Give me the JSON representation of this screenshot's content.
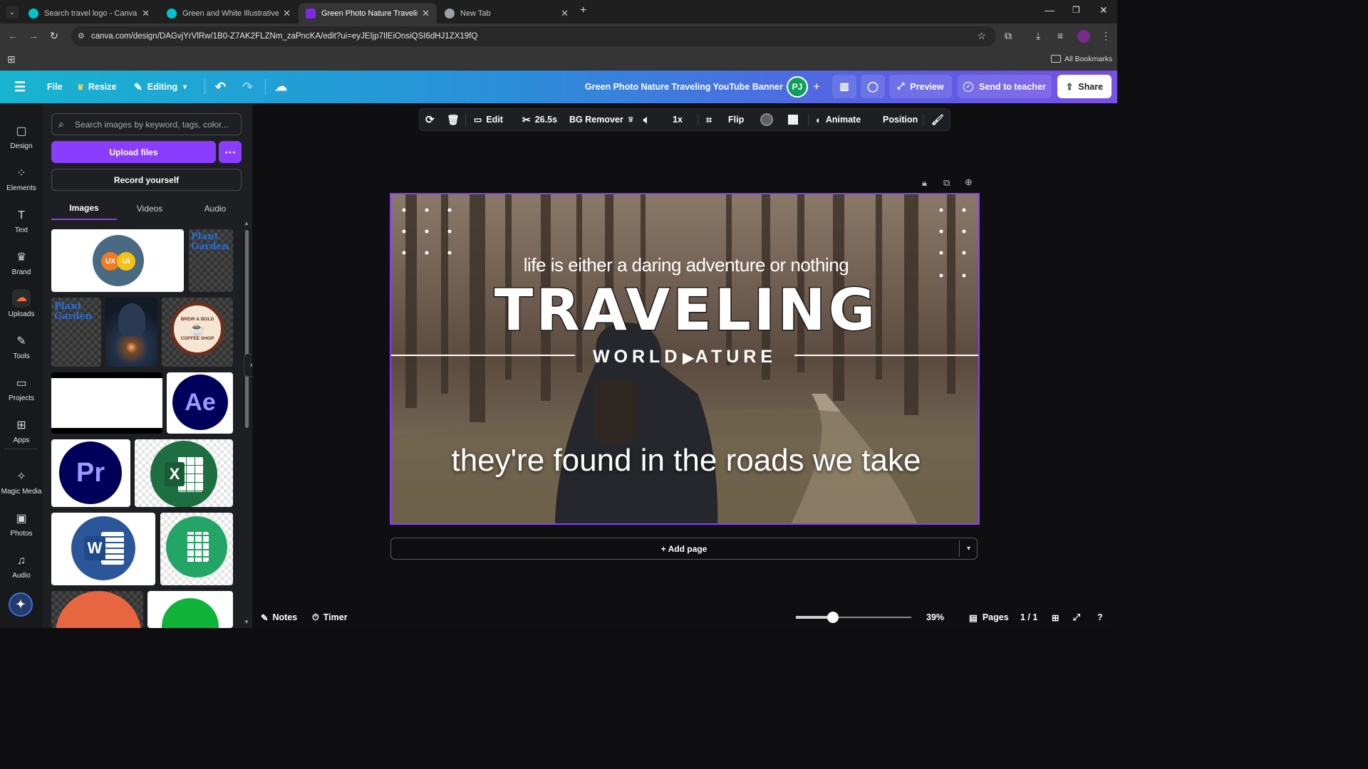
{
  "browser": {
    "tabs": [
      {
        "title": "Search travel logo - Canva",
        "icon": "canva-icon"
      },
      {
        "title": "Green and White Illustrative Tra",
        "icon": "canva-icon"
      },
      {
        "title": "Green Photo Nature Traveling Y",
        "icon": "canva-heart-icon",
        "active": true
      },
      {
        "title": "New Tab",
        "icon": "chrome-icon"
      }
    ],
    "url": "canva.com/design/DAGvjYrVlRw/1B0-Z7AK2FLZNm_zaPncKA/edit?ui=eyJEIjp7IlEiOnsiQSI6dHJ1ZX19fQ",
    "bookmarks_label": "All Bookmarks"
  },
  "header": {
    "file": "File",
    "resize": "Resize",
    "editing": "Editing",
    "doc_title": "Green Photo Nature Traveling YouTube Banner",
    "avatar": "PJ",
    "preview": "Preview",
    "send": "Send to teacher",
    "share": "Share",
    "accent": "#8b3dff"
  },
  "rail": [
    {
      "label": "Design",
      "icon": "design-icon",
      "glyph": "▢"
    },
    {
      "label": "Elements",
      "icon": "elements-icon",
      "glyph": "⁘"
    },
    {
      "label": "Text",
      "icon": "text-icon",
      "glyph": "T"
    },
    {
      "label": "Brand",
      "icon": "brand-icon",
      "glyph": "♛"
    },
    {
      "label": "Uploads",
      "icon": "uploads-icon",
      "glyph": "☁"
    },
    {
      "label": "Tools",
      "icon": "tools-icon",
      "glyph": "✎"
    },
    {
      "label": "Projects",
      "icon": "projects-icon",
      "glyph": "▭"
    },
    {
      "label": "Apps",
      "icon": "apps-icon",
      "glyph": "⊞"
    },
    {
      "label": "Magic Media",
      "icon": "magic-media-icon",
      "glyph": "✧"
    },
    {
      "label": "Photos",
      "icon": "photos-icon",
      "glyph": "▣"
    },
    {
      "label": "Audio",
      "icon": "audio-icon",
      "glyph": "♫"
    }
  ],
  "panel": {
    "search_placeholder": "Search images by keyword, tags, color...",
    "upload": "Upload files",
    "record": "Record yourself",
    "tabs": [
      "Images",
      "Videos",
      "Audio"
    ],
    "active_tab": "Images",
    "thumbs": {
      "uxui_a": "UX",
      "uxui_b": "UI",
      "plant1": "Plant Garden",
      "plant2": "Plant Garden",
      "coffee_top": "BREW & BOLD",
      "coffee_bottom": "COFFEE SHOP",
      "ae": "Ae",
      "pr": "Pr",
      "xl": "X",
      "w": "W"
    }
  },
  "toolbar": {
    "edit": "Edit",
    "duration": "26.5s",
    "bg_remover": "BG Remover",
    "speed": "1x",
    "flip": "Flip",
    "animate": "Animate",
    "position": "Position"
  },
  "design": {
    "tagline": "life is either a daring adventure or nothing",
    "headline": "TRAVELING",
    "subhead_left": "WORLD",
    "subhead_right": "ATURE",
    "caption": "they're found in the roads we take"
  },
  "canvas": {
    "add_page": "+ Add page"
  },
  "footer": {
    "notes": "Notes",
    "timer": "Timer",
    "zoom": "39%",
    "zoom_level": 0.39,
    "pages": "Pages",
    "page_count": "1 / 1"
  }
}
